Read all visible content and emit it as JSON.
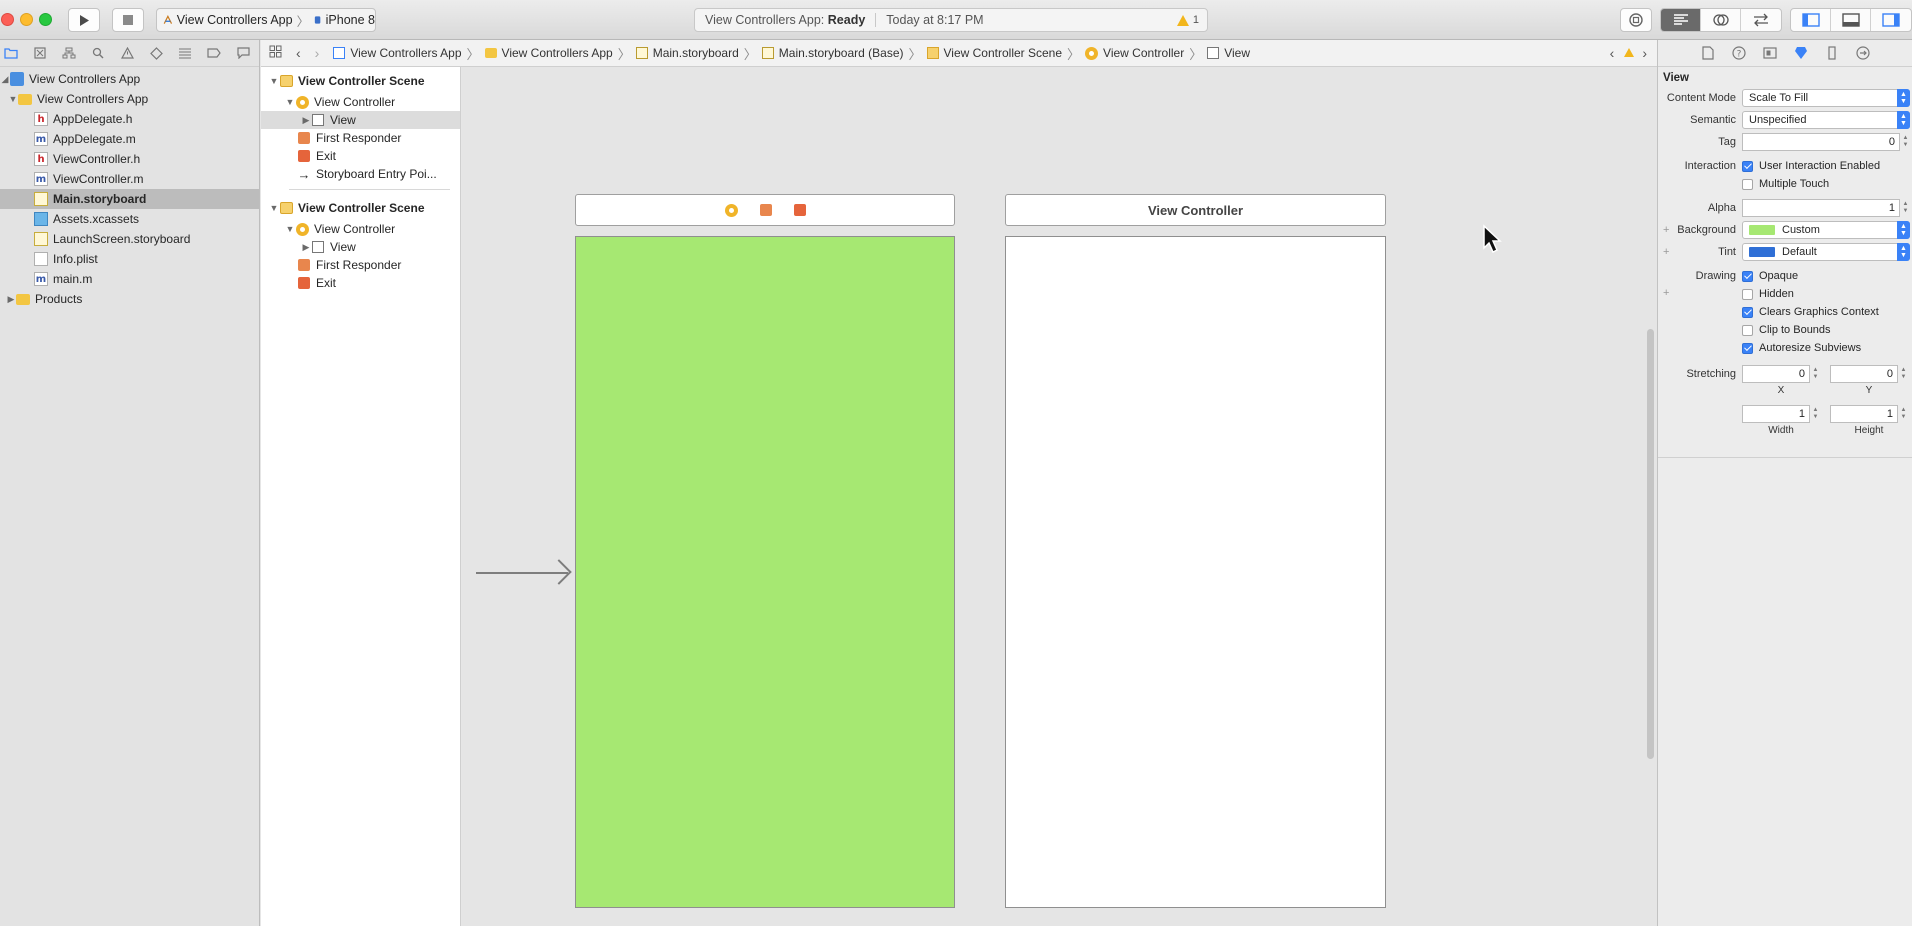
{
  "toolbar": {
    "scheme_name": "View Controllers App",
    "device_name": "iPhone 8",
    "status_app": "View Controllers App:",
    "status_state": "Ready",
    "status_time": "Today at 8:17 PM",
    "warning_count": "1"
  },
  "navigator": {
    "project": "View Controllers App",
    "group": "View Controllers App",
    "files": [
      {
        "name": "AppDelegate.h",
        "kind": "h"
      },
      {
        "name": "AppDelegate.m",
        "kind": "m"
      },
      {
        "name": "ViewController.h",
        "kind": "h"
      },
      {
        "name": "ViewController.m",
        "kind": "m"
      },
      {
        "name": "Main.storyboard",
        "kind": "storyboard"
      },
      {
        "name": "Assets.xcassets",
        "kind": "asset"
      },
      {
        "name": "LaunchScreen.storyboard",
        "kind": "storyboard"
      },
      {
        "name": "Info.plist",
        "kind": "plist"
      },
      {
        "name": "main.m",
        "kind": "m"
      }
    ],
    "products": "Products"
  },
  "jumpbar": {
    "crumbs": [
      "View Controllers App",
      "View Controllers App",
      "Main.storyboard",
      "Main.storyboard (Base)",
      "View Controller Scene",
      "View Controller",
      "View"
    ]
  },
  "outline": {
    "scene1": {
      "title": "View Controller Scene",
      "controller": "View Controller",
      "view": "View",
      "first_responder": "First Responder",
      "exit": "Exit",
      "entry": "Storyboard Entry Poi..."
    },
    "scene2": {
      "title": "View Controller Scene",
      "controller": "View Controller",
      "view": "View",
      "first_responder": "First Responder",
      "exit": "Exit"
    }
  },
  "canvas": {
    "scene2_title": "View Controller",
    "scene1_view_color": "#a6e872"
  },
  "inspector": {
    "title": "View",
    "content_mode_label": "Content Mode",
    "content_mode_value": "Scale To Fill",
    "semantic_label": "Semantic",
    "semantic_value": "Unspecified",
    "tag_label": "Tag",
    "tag_value": "0",
    "interaction_label": "Interaction",
    "user_interaction": "User Interaction Enabled",
    "multiple_touch": "Multiple Touch",
    "alpha_label": "Alpha",
    "alpha_value": "1",
    "background_label": "Background",
    "background_value": "Custom",
    "background_color": "#a6e872",
    "tint_label": "Tint",
    "tint_value": "Default",
    "tint_color": "#2f6fd6",
    "drawing_label": "Drawing",
    "opaque": "Opaque",
    "hidden": "Hidden",
    "clears_graphics": "Clears Graphics Context",
    "clip_to_bounds": "Clip to Bounds",
    "autoresize": "Autoresize Subviews",
    "stretching_label": "Stretching",
    "stretch_x": "0",
    "stretch_y": "0",
    "stretch_w": "1",
    "stretch_h": "1",
    "x_label": "X",
    "y_label": "Y",
    "width_label": "Width",
    "height_label": "Height"
  }
}
